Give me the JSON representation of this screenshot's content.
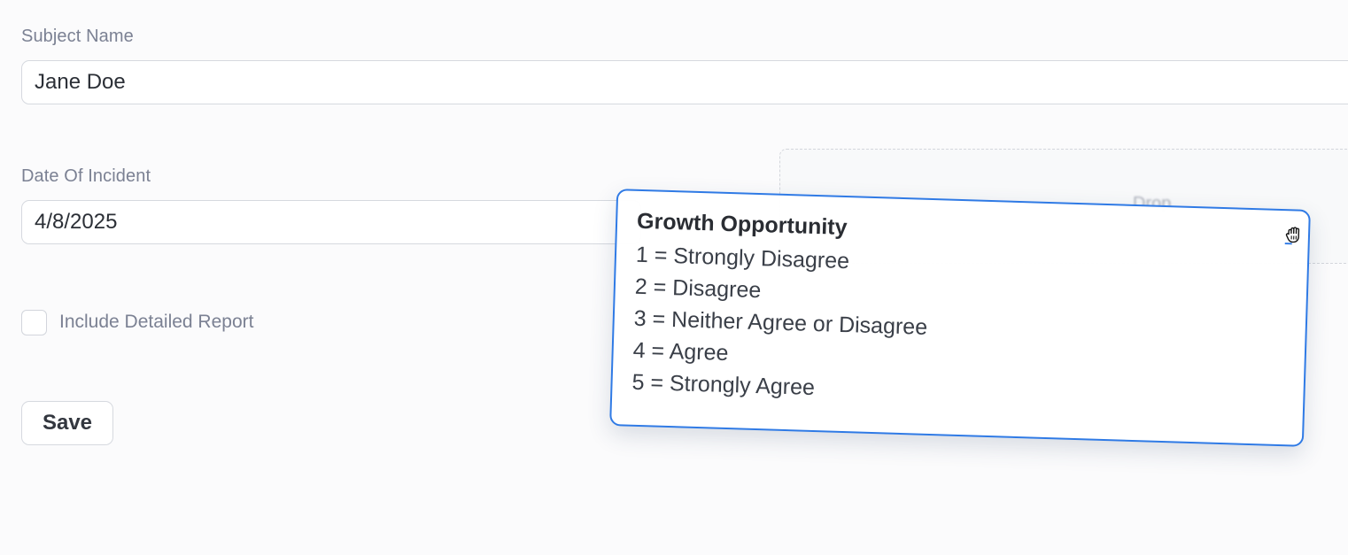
{
  "form": {
    "subject_name": {
      "label": "Subject Name",
      "value": "Jane Doe"
    },
    "date_of_incident": {
      "label": "Date Of Incident",
      "value": "4/8/2025"
    },
    "include_detailed_report": {
      "label": "Include Detailed Report",
      "checked": false
    },
    "save_label": "Save"
  },
  "drop_zone": {
    "label": "Drop"
  },
  "dragged_card": {
    "title": "Growth Opportunity",
    "lines": [
      "1 = Strongly Disagree",
      "2 = Disagree",
      "3 = Neither Agree or Disagree",
      "4 = Agree",
      "5 = Strongly Agree"
    ],
    "cursor_icon": "grab-hand-icon"
  },
  "colors": {
    "accent": "#2f7ae5",
    "label": "#7b8193",
    "border": "#d6d9df",
    "background": "#fbfbfc"
  }
}
